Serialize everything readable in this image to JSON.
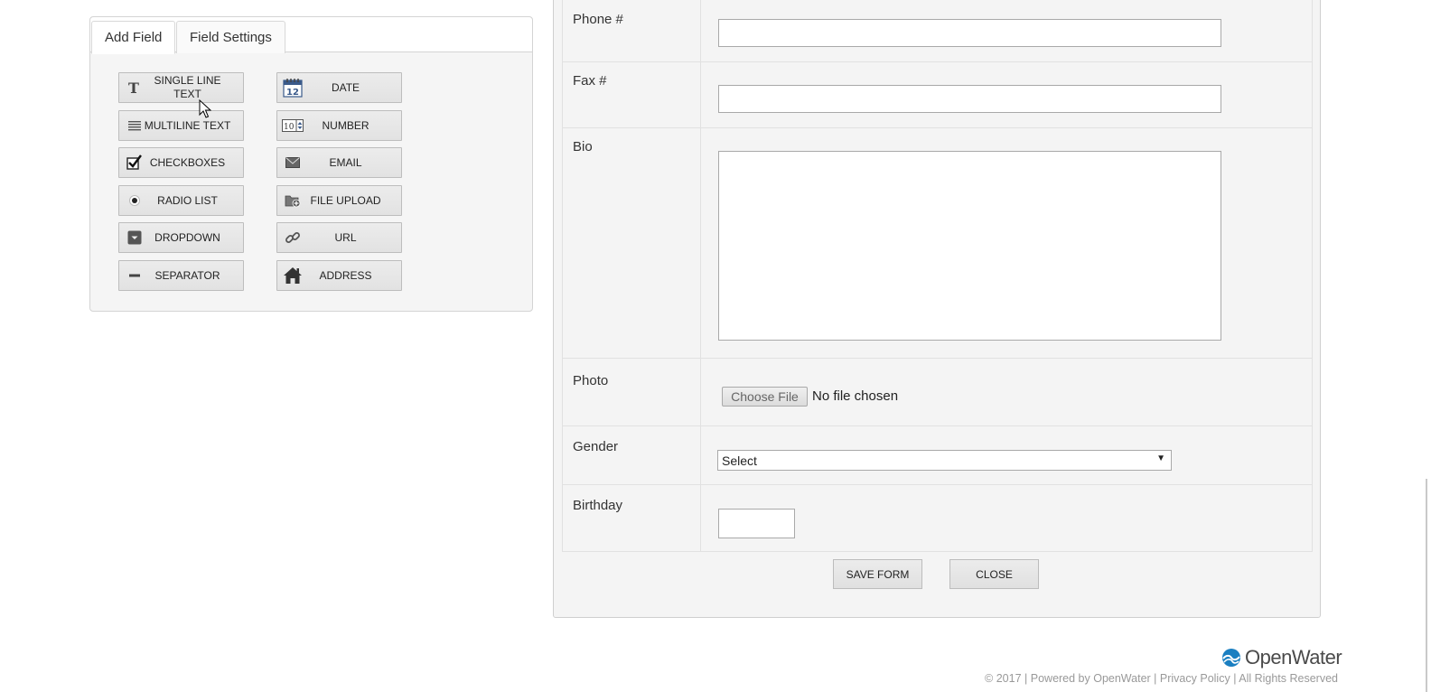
{
  "palette": {
    "tabs": [
      {
        "label": "Add Field"
      },
      {
        "label": "Field Settings"
      }
    ],
    "buttons": [
      {
        "label": "SINGLE LINE TEXT",
        "icon": "text-t-icon"
      },
      {
        "label": "DATE",
        "icon": "calendar-icon"
      },
      {
        "label": "MULTILINE TEXT",
        "icon": "lines-icon"
      },
      {
        "label": "NUMBER",
        "icon": "number-stepper-icon"
      },
      {
        "label": "CHECKBOXES",
        "icon": "checkmark-icon"
      },
      {
        "label": "EMAIL",
        "icon": "envelope-icon"
      },
      {
        "label": "RADIO LIST",
        "icon": "radio-icon"
      },
      {
        "label": "FILE UPLOAD",
        "icon": "folder-upload-icon"
      },
      {
        "label": "DROPDOWN",
        "icon": "dropdown-icon"
      },
      {
        "label": "URL",
        "icon": "link-icon"
      },
      {
        "label": "SEPARATOR",
        "icon": "dash-icon"
      },
      {
        "label": "ADDRESS",
        "icon": "house-icon"
      }
    ],
    "date_icon_number": "12",
    "number_icon_value": "10"
  },
  "form": {
    "fields": [
      {
        "label": "Phone #"
      },
      {
        "label": "Fax #"
      },
      {
        "label": "Bio"
      },
      {
        "label": "Photo"
      },
      {
        "label": "Gender"
      },
      {
        "label": "Birthday"
      }
    ],
    "photo": {
      "button": "Choose File",
      "status": "No file chosen"
    },
    "gender": {
      "selected": "Select",
      "arrow": "▼"
    },
    "actions": {
      "save": "SAVE FORM",
      "close": "CLOSE"
    }
  },
  "footer": {
    "brand": "OpenWater",
    "copyright": "© 2017",
    "sep": "|",
    "powered": "Powered by OpenWater",
    "privacy": "Privacy Policy",
    "rights": "All Rights Reserved"
  },
  "colors": {
    "brand_blue": "#1a7fc1"
  }
}
